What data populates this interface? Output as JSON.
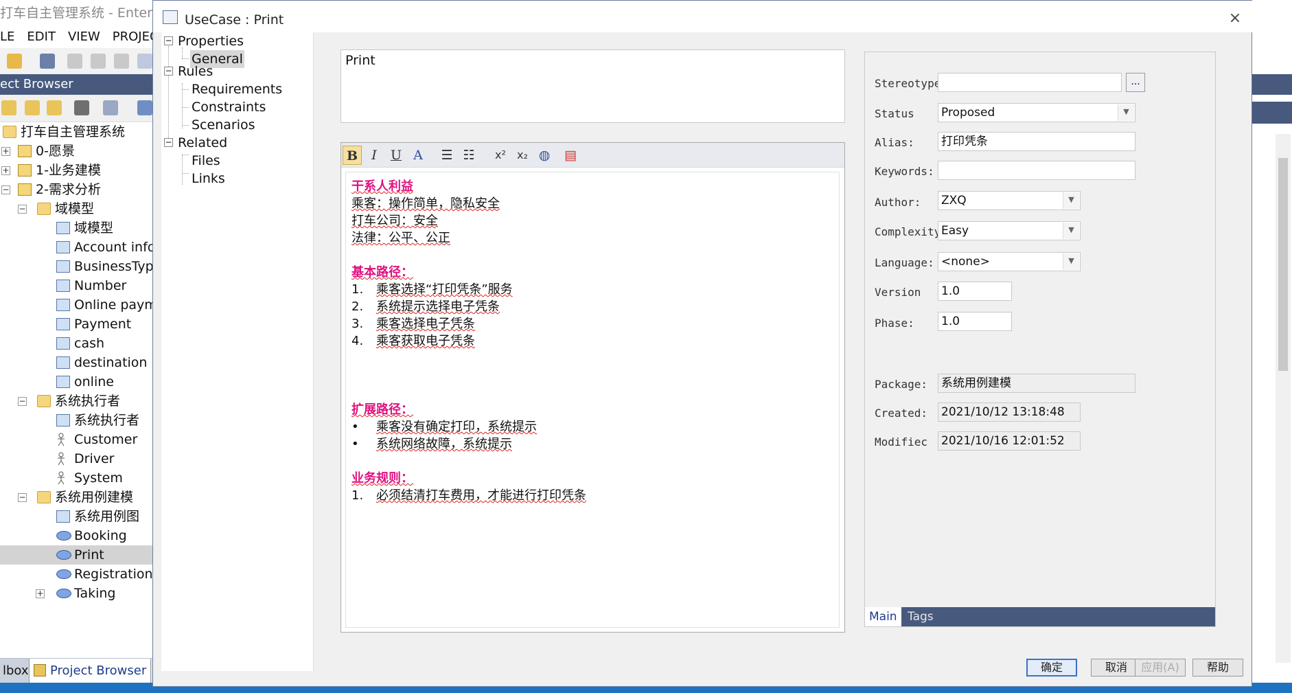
{
  "app": {
    "title": "打车自主管理系统 - Enterprise",
    "menu": [
      "LE",
      "EDIT",
      "VIEW",
      "PROJECT"
    ],
    "project_browser_title": "ect Browser",
    "tree": [
      {
        "label": "打车自主管理系统",
        "icon": "model-root-icon",
        "level": 0,
        "expander": ""
      },
      {
        "label": "0-愿景",
        "icon": "package-icon",
        "level": 1,
        "expander": "+"
      },
      {
        "label": "1-业务建模",
        "icon": "package-icon",
        "level": 1,
        "expander": "+"
      },
      {
        "label": "2-需求分析",
        "icon": "package-icon",
        "level": 1,
        "expander": "−"
      },
      {
        "label": "域模型",
        "icon": "folder-icon",
        "level": 2,
        "expander": "−"
      },
      {
        "label": "域模型",
        "icon": "diagram-icon",
        "level": 3,
        "expander": ""
      },
      {
        "label": "Account infor",
        "icon": "class-icon",
        "level": 3,
        "expander": ""
      },
      {
        "label": "BusinessType",
        "icon": "class-icon",
        "level": 3,
        "expander": ""
      },
      {
        "label": "Number",
        "icon": "class-icon",
        "level": 3,
        "expander": ""
      },
      {
        "label": "Online paym",
        "icon": "class-icon",
        "level": 3,
        "expander": ""
      },
      {
        "label": "Payment",
        "icon": "class-icon",
        "level": 3,
        "expander": ""
      },
      {
        "label": "cash",
        "icon": "class-icon",
        "level": 3,
        "expander": ""
      },
      {
        "label": "destination",
        "icon": "class-icon",
        "level": 3,
        "expander": ""
      },
      {
        "label": "online",
        "icon": "class-icon",
        "level": 3,
        "expander": ""
      },
      {
        "label": "系统执行者",
        "icon": "folder-icon",
        "level": 2,
        "expander": "−"
      },
      {
        "label": "系统执行者",
        "icon": "actor-diagram-icon",
        "level": 3,
        "expander": ""
      },
      {
        "label": "Customer",
        "icon": "actor-icon",
        "level": 3,
        "expander": ""
      },
      {
        "label": "Driver",
        "icon": "actor-icon",
        "level": 3,
        "expander": ""
      },
      {
        "label": "System",
        "icon": "actor-icon",
        "level": 3,
        "expander": ""
      },
      {
        "label": "系统用例建模",
        "icon": "folder-icon",
        "level": 2,
        "expander": "−"
      },
      {
        "label": "系统用例图",
        "icon": "actor-diagram-icon",
        "level": 3,
        "expander": ""
      },
      {
        "label": "Booking",
        "icon": "usecase-icon",
        "level": 3,
        "expander": ""
      },
      {
        "label": "Print",
        "icon": "usecase-icon",
        "level": 3,
        "expander": "",
        "selected": true
      },
      {
        "label": "Registration i",
        "icon": "usecase-icon",
        "level": 3,
        "expander": ""
      },
      {
        "label": "Taking",
        "icon": "usecase-icon",
        "level": 3,
        "expander": "+"
      }
    ],
    "bottom_tabs": {
      "toolbox": "lbox",
      "project_browser": "Project Browser"
    }
  },
  "dialog": {
    "title": "UseCase : Print",
    "close_glyph": "×",
    "nav": {
      "properties": "Properties",
      "general": "General",
      "rules": "Rules",
      "requirements": "Requirements",
      "constraints": "Constraints",
      "scenarios": "Scenarios",
      "related": "Related",
      "files": "Files",
      "links": "Links"
    },
    "name": "Print",
    "editor_toolbar": [
      "B",
      "I",
      "U",
      "A",
      "bullets",
      "numbering",
      "superscript",
      "subscript",
      "hyperlink",
      "notes"
    ],
    "notes": {
      "stakeholders_title": "干系人利益",
      "stakeholders": [
        "乘客：操作简单，隐私安全",
        "打车公司：安全",
        "法律：公平、公正"
      ],
      "basic_title": "基本路径：",
      "basic": [
        {
          "num": "1.",
          "text": "乘客选择“打印凭条”服务"
        },
        {
          "num": "2.",
          "text": "系统提示选择电子凭条"
        },
        {
          "num": "3.",
          "text": "乘客选择电子凭条"
        },
        {
          "num": "4.",
          "text": "乘客获取电子凭条"
        }
      ],
      "extension_title": "扩展路径：",
      "extension": [
        {
          "num": "•",
          "text": "乘客没有确定打印，系统提示"
        },
        {
          "num": "•",
          "text": "系统网络故障，系统提示"
        }
      ],
      "rules_title": "业务规则：",
      "rules": [
        {
          "num": "1.",
          "text": "必须结清打车费用，才能进行打印凭条"
        }
      ]
    },
    "props": {
      "stereotype_label": "Stereotype",
      "stereotype_value": "",
      "stereotype_button": "...",
      "status_label": "Status",
      "status_value": "Proposed",
      "alias_label": "Alias:",
      "alias_value": "打印凭条",
      "keywords_label": "Keywords:",
      "keywords_value": "",
      "author_label": "Author:",
      "author_value": "ZXQ",
      "complexity_label": "Complexity",
      "complexity_value": "Easy",
      "language_label": "Language:",
      "language_value": "<none>",
      "version_label": "Version",
      "version_value": "1.0",
      "phase_label": "Phase:",
      "phase_value": "1.0",
      "package_label": "Package:",
      "package_value": "系统用例建模",
      "created_label": "Created:",
      "created_value": "2021/10/12 13:18:48",
      "modified_label": "Modifiec",
      "modified_value": "2021/10/16 12:01:52",
      "tab_main": "Main",
      "tab_tags": "Tags"
    },
    "buttons": {
      "ok": "确定",
      "cancel": "取消",
      "apply": "应用(A)",
      "help": "帮助"
    }
  },
  "colors": {
    "section_title": "#e0127f",
    "accent_bar": "#475a7e",
    "status_bar": "#1e73c0"
  }
}
